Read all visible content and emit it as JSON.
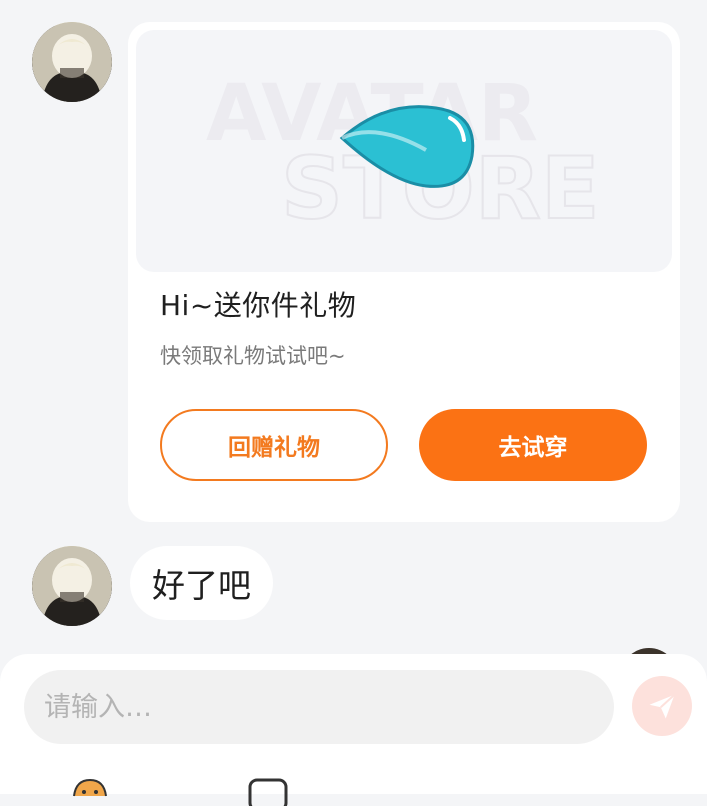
{
  "messages": [
    {
      "type": "gift_card",
      "banner_logo_text": [
        "AVATAR",
        "STORE"
      ],
      "title": "Hi~送你件礼物",
      "subtitle": "快领取礼物试试吧~",
      "actions": {
        "return_gift_label": "回赠礼物",
        "try_on_label": "去试穿"
      }
    },
    {
      "type": "text",
      "text": "好了吧"
    }
  ],
  "composer": {
    "placeholder": "请输入…",
    "value": ""
  },
  "icons": {
    "send": "paper-plane-icon",
    "toolbar_left": "character-emoji-icon",
    "toolbar_right": "image-frame-icon"
  },
  "colors": {
    "accent": "#fb7214",
    "outline_accent": "#f37a1f",
    "send_bg": "#fde1dc",
    "drop": "#2bc0d3"
  }
}
